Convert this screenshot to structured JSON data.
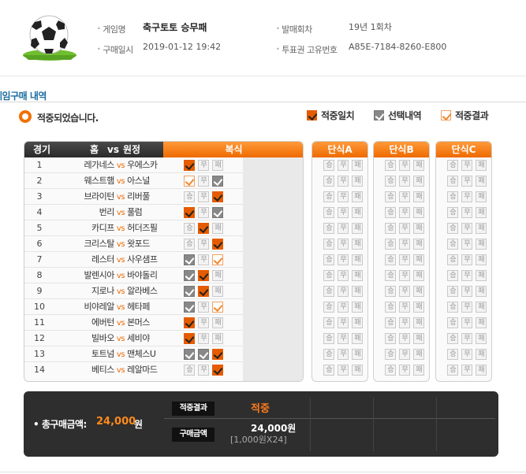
{
  "header": {
    "game_name_label": "게임명",
    "game_name": "축구토토 승무패",
    "purchase_time_label": "구매일시",
    "purchase_time": "2019-01-12 19:42",
    "round_label": "발매회차",
    "round": "19년 1회차",
    "ticket_id_label": "투표권 고유번호",
    "ticket_id": "A85E-7184-8260-E800"
  },
  "section_title": "게임구매 내역",
  "status_text": "적중되었습니다.",
  "legend": {
    "win": "적중일치",
    "selected": "선택내역",
    "result": "적중결과"
  },
  "table_header": {
    "game_no": "경기",
    "matchup_home": "홈",
    "matchup_vs": "vs",
    "matchup_away": "원정",
    "multi": "복식",
    "single_a": "단식A",
    "single_b": "단식B",
    "single_c": "단식C"
  },
  "option_labels": [
    "승",
    "무",
    "패"
  ],
  "vs_text": "vs",
  "games": [
    {
      "no": "1",
      "home": "레가네스",
      "away": "우에스카",
      "marks": [
        "win",
        "",
        ""
      ]
    },
    {
      "no": "2",
      "home": "웨스트햄",
      "away": "아스널",
      "marks": [
        "res",
        "",
        "sel"
      ]
    },
    {
      "no": "3",
      "home": "브라이턴",
      "away": "리버풀",
      "marks": [
        "",
        "",
        "win"
      ]
    },
    {
      "no": "4",
      "home": "번리",
      "away": "풀럼",
      "marks": [
        "win",
        "",
        "sel"
      ]
    },
    {
      "no": "5",
      "home": "카디프",
      "away": "허더즈필",
      "marks": [
        "",
        "win",
        ""
      ]
    },
    {
      "no": "6",
      "home": "크리스탈",
      "away": "왓포드",
      "marks": [
        "",
        "",
        "win"
      ]
    },
    {
      "no": "7",
      "home": "레스터",
      "away": "사우샘프",
      "marks": [
        "sel",
        "",
        "res"
      ]
    },
    {
      "no": "8",
      "home": "발렌시아",
      "away": "바야돌리",
      "marks": [
        "sel",
        "win",
        ""
      ]
    },
    {
      "no": "9",
      "home": "지로나",
      "away": "알라베스",
      "marks": [
        "sel",
        "win",
        ""
      ]
    },
    {
      "no": "10",
      "home": "비야레알",
      "away": "헤타페",
      "marks": [
        "sel",
        "",
        "res"
      ]
    },
    {
      "no": "11",
      "home": "에버턴",
      "away": "본머스",
      "marks": [
        "win",
        "",
        ""
      ]
    },
    {
      "no": "12",
      "home": "빌바오",
      "away": "세비야",
      "marks": [
        "win",
        "",
        ""
      ]
    },
    {
      "no": "13",
      "home": "토트넘",
      "away": "맨체스U",
      "marks": [
        "sel",
        "sel",
        "win"
      ]
    },
    {
      "no": "14",
      "home": "베티스",
      "away": "레알마드",
      "marks": [
        "",
        "",
        "win"
      ]
    }
  ],
  "summary": {
    "total_label": "총구매금액:",
    "total_value": "24,000",
    "total_unit": "원",
    "result_tag": "적중결과",
    "result_value": "적중",
    "amount_tag": "구매금액",
    "amount_value": "24,000원",
    "amount_breakdown": "[1,000원X24]"
  },
  "colors": {
    "accent": "#f06a00",
    "title_blue": "#1a6ea0",
    "summary_bg": "#2e2e2e"
  }
}
